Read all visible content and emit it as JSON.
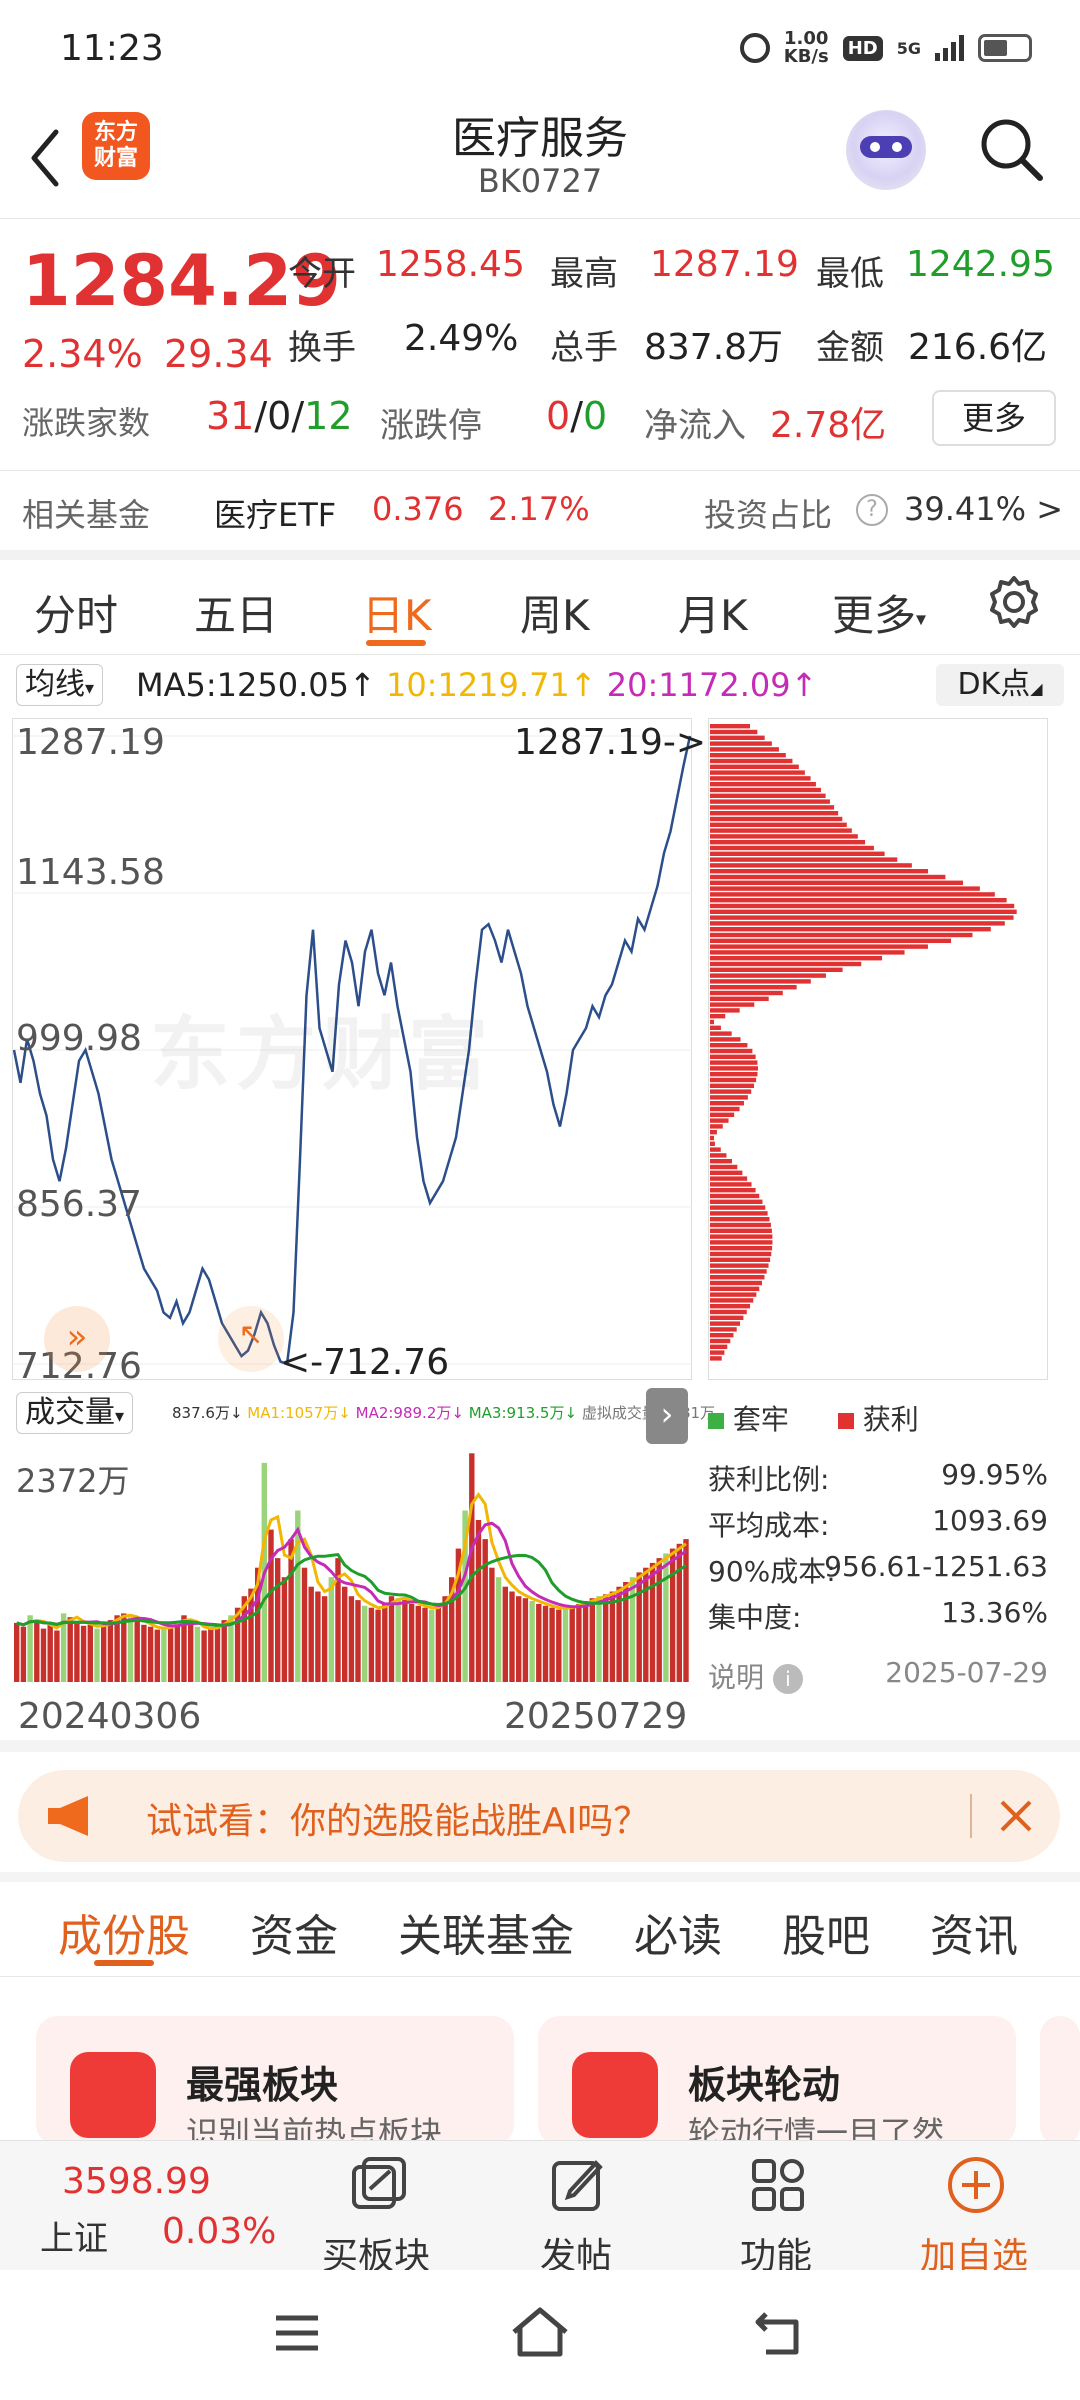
{
  "status_bar": {
    "time": "11:23",
    "net_speed_value": "1.00",
    "net_speed_unit": "KB/s",
    "hd": "HD",
    "signal": "5G"
  },
  "header": {
    "logo_text": "东方财富",
    "title": "医疗服务",
    "code": "BK0727"
  },
  "quote": {
    "price": "1284.29",
    "change_pct": "2.34%",
    "change_amt": "29.34",
    "open_label": "今开",
    "open": "1258.45",
    "high_label": "最高",
    "high": "1287.19",
    "low_label": "最低",
    "low": "1242.95",
    "turnover_label": "换手",
    "turnover": "2.49%",
    "volume_label": "总手",
    "volume": "837.8万",
    "amount_label": "金额",
    "amount": "216.6亿",
    "breadth_label": "涨跌家数",
    "up": "31",
    "flat": "0",
    "down": "12",
    "limit_label": "涨跌停",
    "limit_up": "0",
    "limit_down": "0",
    "netflow_label": "净流入",
    "netflow": "2.78亿",
    "more_button": "更多",
    "slash": "/"
  },
  "fund": {
    "label": "相关基金",
    "name": "医疗ETF",
    "price": "0.376",
    "pct": "2.17%",
    "ratio_label": "投资占比",
    "ratio": "39.41% >"
  },
  "chart_tabs": [
    "分时",
    "五日",
    "日K",
    "周K",
    "月K",
    "更多"
  ],
  "ma_bar": {
    "selector": "均线",
    "ma5": "MA5:1250.05",
    "ma10": "10:1219.71",
    "ma20": "20:1172.09",
    "dk": "DK点"
  },
  "colors": {
    "accent": "#f06a1e",
    "up": "#e03232",
    "down": "#1f9e2b",
    "line": "#2c4e8a",
    "ma10": "#f2b705",
    "ma20": "#c42bb6"
  },
  "chart_data": [
    {
      "type": "line",
      "title": "",
      "xlabel": "",
      "ylabel": "",
      "x_range": [
        "20240306",
        "20250729"
      ],
      "ylim": [
        712.76,
        1287.19
      ],
      "y_ticks": [
        "1287.19",
        "1143.58",
        "999.98",
        "856.37",
        "712.76"
      ],
      "annotations": [
        "1287.19->",
        "<-712.76"
      ],
      "watermark": "东方财富",
      "series": [
        {
          "values": [
            1000,
            970,
            1010,
            990,
            960,
            940,
            900,
            880,
            910,
            950,
            990,
            1000,
            980,
            960,
            930,
            900,
            880,
            860,
            840,
            820,
            800,
            790,
            780,
            760,
            755,
            770,
            750,
            760,
            780,
            800,
            790,
            770,
            750,
            740,
            730,
            720,
            725,
            740,
            760,
            750,
            730,
            715,
            712.76,
            760,
            900,
            1050,
            1110,
            1020,
            1000,
            980,
            1060,
            1100,
            1080,
            1040,
            1090,
            1110,
            1070,
            1050,
            1080,
            1040,
            1010,
            980,
            920,
            880,
            860,
            870,
            880,
            900,
            920,
            960,
            1000,
            1060,
            1110,
            1115,
            1100,
            1080,
            1110,
            1090,
            1070,
            1040,
            1020,
            1000,
            980,
            950,
            930,
            960,
            1000,
            1010,
            1020,
            1040,
            1030,
            1050,
            1060,
            1080,
            1100,
            1090,
            1120,
            1110,
            1130,
            1150,
            1180,
            1200,
            1230,
            1260,
            1287.19
          ]
        }
      ]
    },
    {
      "type": "bar",
      "title": "成交量",
      "legend": [
        "837.6万↓",
        "MA1:1057万↓",
        "MA2:989.2万↓",
        "MA3:913.5万↓",
        "虚拟成交量:1181万"
      ],
      "ylim": [
        0,
        2372
      ],
      "y_tick": "2372万",
      "categories_range": [
        "20240306",
        "20250729"
      ],
      "series": [
        {
          "values": [
            620,
            580,
            700,
            650,
            560,
            600,
            540,
            720,
            680,
            640,
            590,
            600,
            560,
            610,
            650,
            700,
            720,
            680,
            650,
            600,
            580,
            550,
            560,
            600,
            640,
            700,
            620,
            580,
            540,
            560,
            600,
            650,
            700,
            780,
            900,
            980,
            1200,
            2300,
            1600,
            1300,
            1100,
            1500,
            1800,
            1200,
            1000,
            950,
            900,
            1100,
            1300,
            1000,
            900,
            860,
            800,
            780,
            760,
            820,
            900,
            880,
            860,
            820,
            800,
            780,
            760,
            800,
            900,
            1100,
            1400,
            1800,
            2400,
            1700,
            1500,
            1200,
            1100,
            1000,
            950,
            900,
            880,
            850,
            820,
            800,
            780,
            760,
            780,
            800,
            820,
            850,
            880,
            900,
            920,
            950,
            1000,
            1050,
            1100,
            1150,
            1200,
            1250,
            1300,
            1350,
            1400,
            1450,
            1500
          ]
        }
      ]
    }
  ],
  "volume_bar": {
    "selector": "成交量"
  },
  "cost_panel": {
    "legend_trapped": "套牢",
    "legend_profit": "获利",
    "profit_ratio_label": "获利比例:",
    "profit_ratio": "99.95%",
    "avg_cost_label": "平均成本:",
    "avg_cost": "1093.69",
    "cost90_label": "90%成本:",
    "cost90": "956.61-1251.63",
    "concentration_label": "集中度:",
    "concentration": "13.36%",
    "note_label": "说明",
    "date": "2025-07-29"
  },
  "promo": {
    "text": "试试看：你的选股能战胜AI吗？"
  },
  "bottom_tabs": [
    "成份股",
    "资金",
    "关联基金",
    "必读",
    "股吧",
    "资讯"
  ],
  "cards": [
    {
      "title": "最强板块",
      "subtitle": "识别当前热点板块"
    },
    {
      "title": "板块轮动",
      "subtitle": "轮动行情一目了然"
    }
  ],
  "index_ticker": {
    "value": "3598.99",
    "name": "上证",
    "pct": "0.03%"
  },
  "bottom_bar": {
    "buy_sector": "买板块",
    "post": "发帖",
    "functions": "功能",
    "add_watch": "加自选"
  }
}
